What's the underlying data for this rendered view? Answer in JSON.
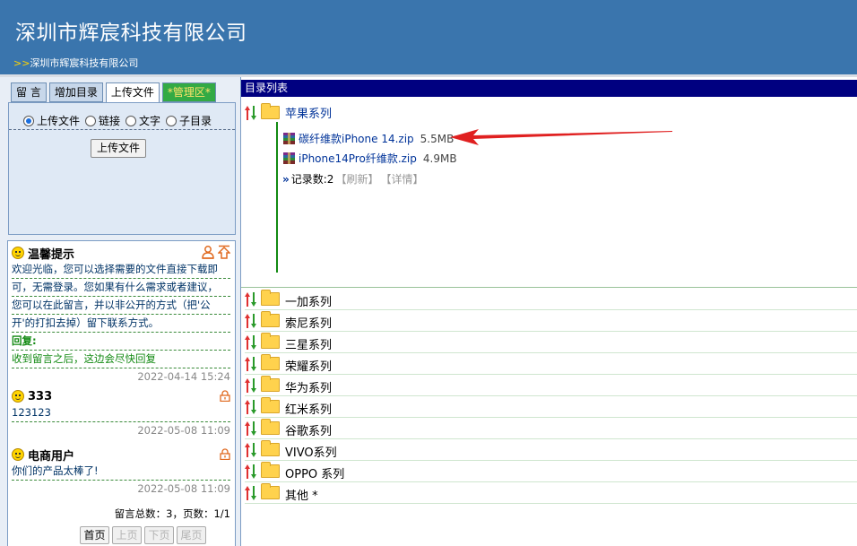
{
  "header": {
    "title": "深圳市辉宸科技有限公司",
    "crumb_arrows": ">>",
    "crumb": "深圳市辉宸科技有限公司"
  },
  "tabs": [
    {
      "label": "留 言"
    },
    {
      "label": "增加目录"
    },
    {
      "label": "上传文件"
    },
    {
      "label": "*管理区*"
    }
  ],
  "upload": {
    "options": [
      "上传文件",
      "链接",
      "文字",
      "子目录"
    ],
    "selected": 0,
    "button": "上传文件"
  },
  "notes": {
    "items": [
      {
        "title": "温馨提示",
        "lines": [
          "欢迎光临，您可以选择需要的文件直接下载即",
          "可，无需登录。您如果有什么需求或者建议，",
          "您可以在此留言，并以非公开的方式（把'公",
          "开'的打扣去掉）留下联系方式。"
        ],
        "reply_heading": "回复:",
        "reply": "收到留言之后，这边会尽快回复",
        "time": "2022-04-14 15:24"
      },
      {
        "title": "333",
        "lines": [
          "123123"
        ],
        "time": "2022-05-08 11:09"
      },
      {
        "title": "电商用户",
        "lines": [
          "你们的产品太棒了!"
        ],
        "time": "2022-05-08 11:09"
      }
    ],
    "summary": "留言总数：3，页数：1/1",
    "pager": [
      "首页",
      "上页",
      "下页",
      "尾页"
    ]
  },
  "directory": {
    "header": "目录列表",
    "open_folder": "苹果系列",
    "files": [
      {
        "name": "碳纤维款iPhone 14.zip",
        "size": "5.5MB"
      },
      {
        "name": "iPhone14Pro纤维款.zip",
        "size": "4.9MB"
      }
    ],
    "record_prefix": "»",
    "record_count": "记录数:2",
    "refresh": "【刷新】",
    "detail": "【详情】",
    "folders": [
      "一加系列",
      "索尼系列",
      "三星系列",
      "荣耀系列",
      "华为系列",
      "红米系列",
      "谷歌系列",
      "VIVO系列",
      "OPPO 系列",
      "其他 *"
    ]
  },
  "colors": {
    "header_bg": "#3a75ad",
    "dir_header_bg": "#000080",
    "link": "#003399",
    "reply": "#138a13",
    "arrow": "#e02020"
  }
}
